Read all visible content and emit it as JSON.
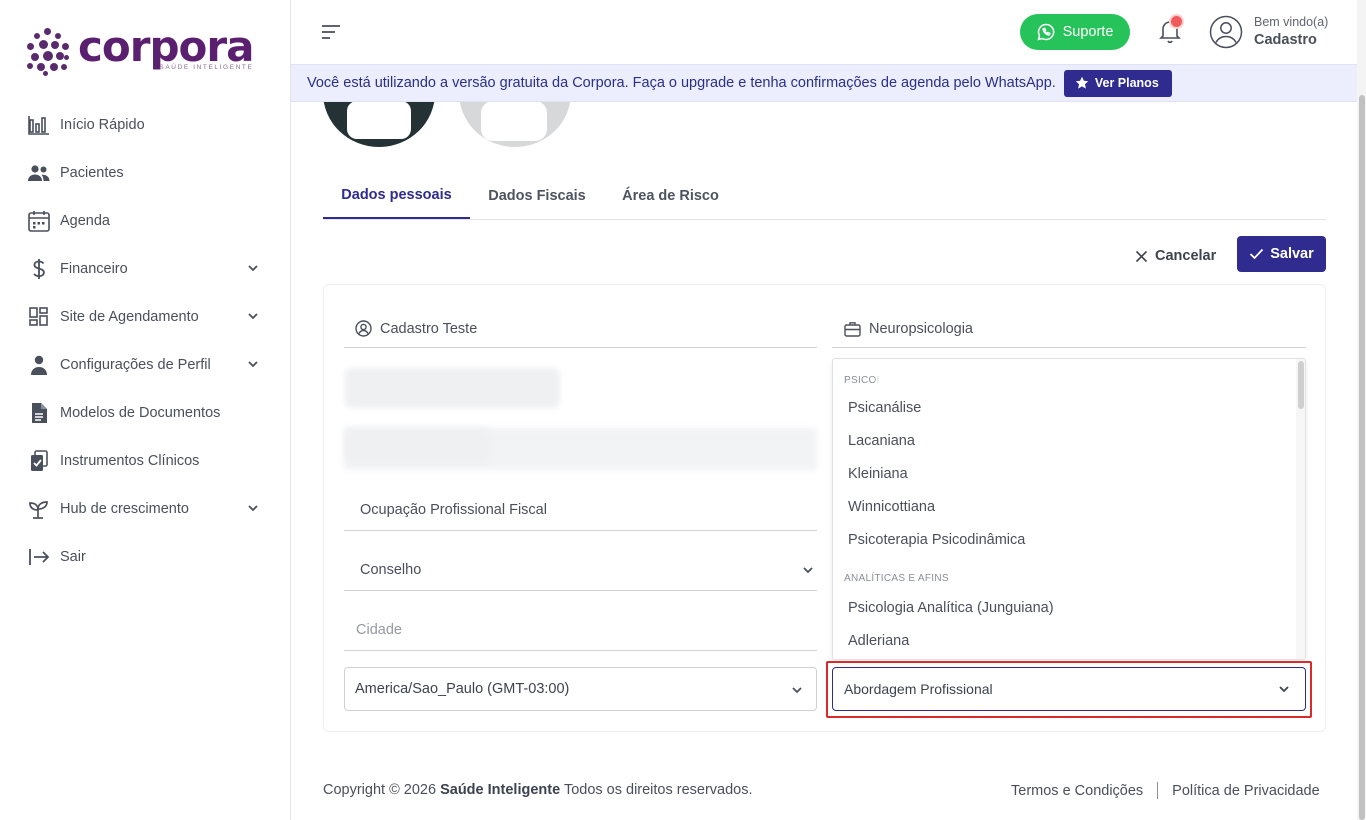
{
  "brand": {
    "name": "corpora",
    "tagline": "SAÚDE INTELIGENTE",
    "color": "#5b1f6f"
  },
  "sidebar": {
    "items": [
      {
        "label": "Início Rápido",
        "icon": "bar-chart-icon",
        "expandable": false
      },
      {
        "label": "Pacientes",
        "icon": "users-icon",
        "expandable": false
      },
      {
        "label": "Agenda",
        "icon": "calendar-icon",
        "expandable": false
      },
      {
        "label": "Financeiro",
        "icon": "dollar-icon",
        "expandable": true
      },
      {
        "label": "Site de Agendamento",
        "icon": "dashboard-grid-icon",
        "expandable": true
      },
      {
        "label": "Configurações de Perfil",
        "icon": "person-icon",
        "expandable": true
      },
      {
        "label": "Modelos de Documentos",
        "icon": "document-icon",
        "expandable": false
      },
      {
        "label": "Instrumentos Clínicos",
        "icon": "clipboard-check-icon",
        "expandable": false
      },
      {
        "label": "Hub de crescimento",
        "icon": "sprout-icon",
        "expandable": true
      },
      {
        "label": "Sair",
        "icon": "logout-icon",
        "expandable": false
      }
    ]
  },
  "header": {
    "support_label": "Suporte",
    "support_color": "#25c35a",
    "welcome": "Bem vindo(a)",
    "user": "Cadastro"
  },
  "banner": {
    "text": "Você está utilizando a versão gratuita da Corpora. Faça o upgrade e tenha confirmações de agenda pelo WhatsApp.",
    "button": "Ver Planos"
  },
  "tabs": [
    {
      "label": "Dados pessoais",
      "active": true
    },
    {
      "label": "Dados Fiscais",
      "active": false
    },
    {
      "label": "Área de Risco",
      "active": false
    }
  ],
  "actions": {
    "cancel": "Cancelar",
    "save": "Salvar",
    "accent": "#2f2b8f"
  },
  "form": {
    "name_value": "Cadastro Teste",
    "specialty_value": "Neuropsicologia",
    "occupation_placeholder": "Ocupação Profissional Fiscal",
    "council_placeholder": "Conselho",
    "city_placeholder": "Cidade",
    "timezone_value": "America/Sao_Paulo (GMT-03:00)",
    "approach_placeholder": "Abordagem Profissional"
  },
  "dropdown": {
    "group1": "PSICOI",
    "group1_options": [
      "Psicanálise",
      "Lacaniana",
      "Kleiniana",
      "Winnicottiana",
      "Psicoterapia Psicodinâmica"
    ],
    "group2": "ANALÍTICAS E AFINS",
    "group2_options": [
      "Psicologia Analítica (Junguiana)",
      "Adleriana"
    ]
  },
  "footer": {
    "copyright_prefix": "Copyright © 2026",
    "company": "Saúde Inteligente",
    "rights": "Todos os direitos reservados.",
    "terms": "Termos e Condições",
    "privacy": "Política de Privacidade"
  }
}
